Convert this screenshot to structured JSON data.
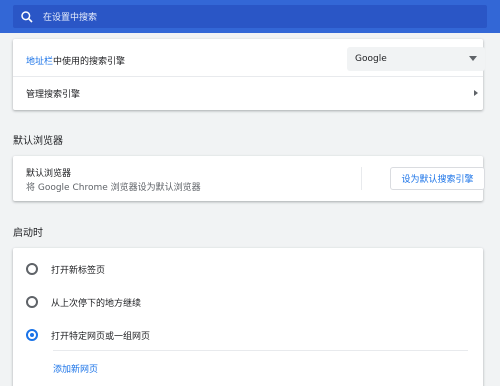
{
  "search": {
    "placeholder": "在设置中搜索"
  },
  "search_engine": {
    "address_bar_link": "地址栏",
    "address_bar_rest": "中使用的搜索引擎",
    "selected_engine": "Google",
    "manage_label": "管理搜索引擎"
  },
  "default_browser": {
    "section_title": "默认浏览器",
    "title": "默认浏览器",
    "subtitle": "将 Google Chrome 浏览器设为默认浏览器",
    "button": "设为默认搜索引擎"
  },
  "startup": {
    "section_title": "启动时",
    "options": [
      {
        "label": "打开新标签页",
        "selected": false
      },
      {
        "label": "从上次停下的地方继续",
        "selected": false
      },
      {
        "label": "打开特定网页或一组网页",
        "selected": true
      }
    ],
    "add_page": "添加新网页"
  },
  "colors": {
    "header": "#3367d6",
    "accent": "#1a73e8"
  }
}
